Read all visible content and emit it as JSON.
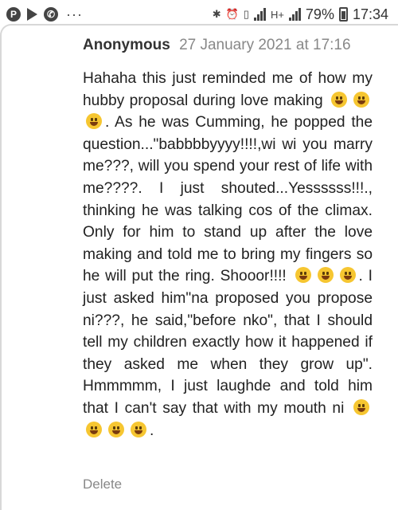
{
  "status_bar": {
    "app_icons": [
      "P",
      "play",
      "phone"
    ],
    "overflow": "···",
    "network": "H+",
    "battery": "79%",
    "time": "17:34"
  },
  "comment": {
    "author": "Anonymous",
    "date": "27 January 2021 at 17:16",
    "segments": [
      "Hahaha this just reminded me of how my hubby proposal during love making ",
      ". As he was Cumming, he popped the question...\"babbbbyyyy!!!!,wi wi you marry me???, will you spend your rest of life with me????. I just shouted...Yessssss!!!., thinking he was talking cos of the climax. Only for him to stand up after the love making and told me to bring my fingers so he will put the ring. Shooor!!!! ",
      ". I just asked him\"na proposed you propose ni???, he said,\"before nko\", that I should tell my children exactly how it happened if they asked me when they grow up\". Hmmmmm, I just laughde and told him that I can't say that with my mouth ni ",
      "."
    ],
    "delete_label": "Delete"
  }
}
